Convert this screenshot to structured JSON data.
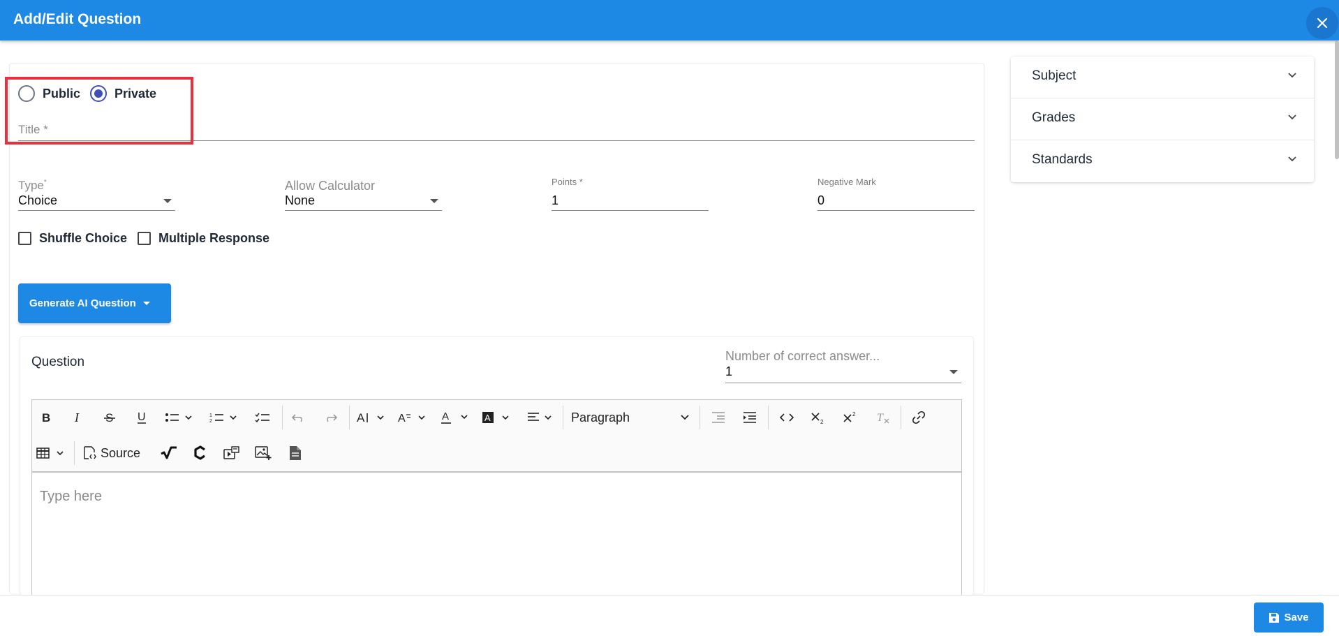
{
  "header": {
    "title": "Add/Edit Question"
  },
  "visibility": {
    "options": [
      "Public",
      "Private"
    ],
    "selected": "Private"
  },
  "title_field": {
    "label": "Title *",
    "value": ""
  },
  "fields": {
    "type": {
      "label": "Type",
      "required_mark": "*",
      "value": "Choice"
    },
    "allow_calculator": {
      "label": "Allow Calculator",
      "value": "None"
    },
    "points": {
      "label": "Points *",
      "value": "1"
    },
    "negative_mark": {
      "label": "Negative Mark",
      "value": "0"
    }
  },
  "checkboxes": [
    {
      "label": "Shuffle Choice",
      "checked": false
    },
    {
      "label": "Multiple Response",
      "checked": false
    }
  ],
  "ai_button": {
    "label": "Generate AI Question"
  },
  "question": {
    "title": "Question",
    "correct_answers": {
      "label": "Number of correct answer...",
      "value": "1"
    },
    "toolbar": {
      "paragraph_label": "Paragraph",
      "source_label": "Source"
    },
    "editor_placeholder": "Type here"
  },
  "sidebar": {
    "items": [
      {
        "label": "Subject"
      },
      {
        "label": "Grades"
      },
      {
        "label": "Standards"
      }
    ]
  },
  "footer": {
    "save_label": "Save"
  },
  "colors": {
    "primary": "#1e88e5",
    "radio_accent": "#3f51b5",
    "highlight": "#e5323c"
  }
}
